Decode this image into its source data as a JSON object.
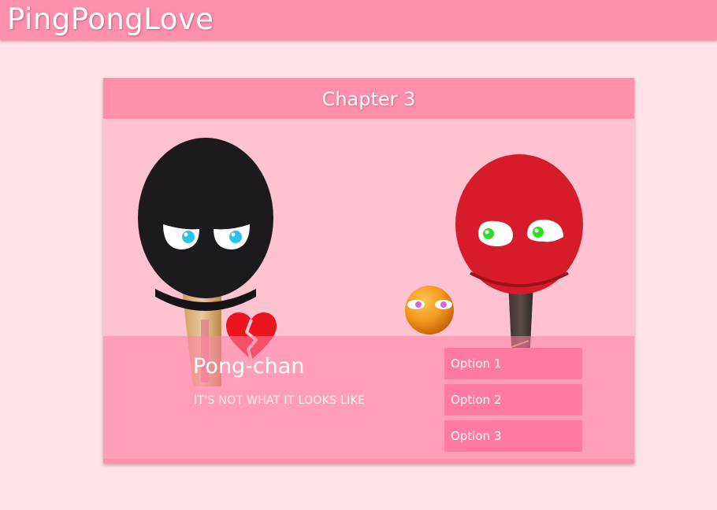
{
  "app": {
    "title": "PingPongLove"
  },
  "chapter": {
    "title": "Chapter 3"
  },
  "dialogue": {
    "speaker": "Pong-chan",
    "text": "IT'S NOT WHAT IT LOOKS LIKE"
  },
  "options": [
    {
      "label": "Option 1"
    },
    {
      "label": "Option 2"
    },
    {
      "label": "Option 3"
    }
  ],
  "characters": {
    "left_paddle": {
      "icon": "black-paddle-icon",
      "mood": "jealous",
      "rubber_color": "#1c1a1c"
    },
    "right_paddle": {
      "icon": "red-paddle-icon",
      "rubber_color": "#d61c2a"
    },
    "ball": {
      "icon": "orange-ball-icon",
      "color": "#f39a1e"
    },
    "heart": {
      "icon": "broken-heart-icon",
      "color": "#e8141e"
    }
  },
  "colors": {
    "page_background": "#ffe3e9",
    "header_pink": "#ff8fab",
    "scene_pink": "#ffc2d1",
    "option_pink": "#ff7aa0"
  }
}
